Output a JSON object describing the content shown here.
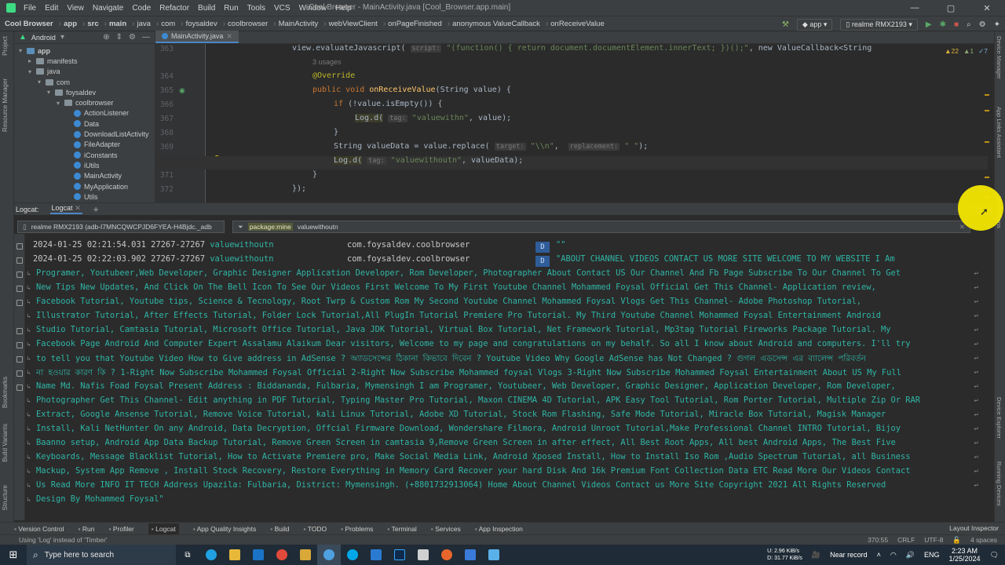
{
  "titlebar": {
    "menu": [
      "File",
      "Edit",
      "View",
      "Navigate",
      "Code",
      "Refactor",
      "Build",
      "Run",
      "Tools",
      "VCS",
      "Window",
      "Help"
    ],
    "title": "Cool Browser - MainActivity.java [Cool_Browser.app.main]",
    "win_min": "—",
    "win_max": "▢",
    "win_close": "✕"
  },
  "navbar": {
    "crumbs": [
      "Cool Browser",
      "app",
      "src",
      "main",
      "java",
      "com",
      "foysaldev",
      "coolbrowser",
      "MainActivity",
      "webViewClient",
      "onPageFinished",
      "anonymous ValueCallback",
      "onReceiveValue"
    ],
    "run_config": "app",
    "device": "realme RMX2193"
  },
  "project": {
    "view": "Android",
    "tree": [
      {
        "label": "app",
        "indent": 0,
        "kind": "folder-blue",
        "arrow": "▾"
      },
      {
        "label": "manifests",
        "indent": 1,
        "kind": "folder",
        "arrow": "▸"
      },
      {
        "label": "java",
        "indent": 1,
        "kind": "folder",
        "arrow": "▾"
      },
      {
        "label": "com",
        "indent": 2,
        "kind": "folder",
        "arrow": "▾"
      },
      {
        "label": "foysaldev",
        "indent": 3,
        "kind": "folder",
        "arrow": "▾"
      },
      {
        "label": "coolbrowser",
        "indent": 4,
        "kind": "folder",
        "arrow": "▾"
      },
      {
        "label": "ActionListener",
        "indent": 5,
        "kind": "class",
        "arrow": ""
      },
      {
        "label": "Data",
        "indent": 5,
        "kind": "class",
        "arrow": ""
      },
      {
        "label": "DownloadListActivity",
        "indent": 5,
        "kind": "class",
        "arrow": ""
      },
      {
        "label": "FileAdapter",
        "indent": 5,
        "kind": "class",
        "arrow": ""
      },
      {
        "label": "iConstants",
        "indent": 5,
        "kind": "class",
        "arrow": ""
      },
      {
        "label": "iUtils",
        "indent": 5,
        "kind": "class",
        "arrow": ""
      },
      {
        "label": "MainActivity",
        "indent": 5,
        "kind": "class",
        "arrow": ""
      },
      {
        "label": "MyApplication",
        "indent": 5,
        "kind": "class",
        "arrow": ""
      },
      {
        "label": "Utils",
        "indent": 5,
        "kind": "class",
        "arrow": ""
      }
    ]
  },
  "editor": {
    "tab": "MainActivity.java",
    "inspections": {
      "warnings": "22",
      "weak": "1",
      "typos": "7"
    },
    "usages": "3 usages",
    "lines": [
      "363",
      "364",
      "365",
      "366",
      "367",
      "368",
      "369",
      "370",
      "371",
      "372"
    ],
    "code_363": "view.evaluateJavascript(",
    "code_363_hint": "script:",
    "code_363_str": "\"(function() { return document.documentElement.innerText; })();\"",
    "code_363_tail": ", new ValueCallback<String",
    "code_364": "@Override",
    "code_365_a": "public void ",
    "code_365_fn": "onReceiveValue",
    "code_365_b": "(String value) {",
    "code_366_a": "if ",
    "code_366_b": "(!value.isEmpty()) {",
    "code_367_a": "Log.d(",
    "code_367_hint": "tag:",
    "code_367_str": "\"valuewithn\"",
    "code_367_b": ", value);",
    "code_368": "}",
    "code_369_a": "String valueData = value.replace(",
    "code_369_hint1": "target:",
    "code_369_str1": "\"\\\\n\"",
    "code_369_comma": ",",
    "code_369_hint2": "replacement:",
    "code_369_str2": "\" \"",
    "code_369_b": ");",
    "code_370_a": "Log.d(",
    "code_370_hint": "tag:",
    "code_370_str": "\"valuewithoutn\"",
    "code_370_b": ", valueData);",
    "code_371": "}",
    "code_372": "});"
  },
  "logcat": {
    "tabs": [
      "Logcat:",
      "Logcat"
    ],
    "device_filter": "realme RMX2193 (adb-I7MNCQWCPJD6FYEA-H4Bjdc._adb",
    "filter_key": "package:mine",
    "filter_value": "valuewithoutn",
    "rows": [
      {
        "time": "2024-01-25 02:21:54.031 27267-27267",
        "tag": "valuewithoutn",
        "pkg": "com.foysaldev.coolbrowser",
        "level": "D",
        "msg": "\"\""
      },
      {
        "time": "2024-01-25 02:22:03.902 27267-27267",
        "tag": "valuewithoutn",
        "pkg": "com.foysaldev.coolbrowser",
        "level": "D",
        "msg": "\"ABOUT   CHANNEL   VIDEOS   CONTACT US   MORE SITE   WELCOME TO MY WEBSITE  I Am"
      }
    ],
    "continuation": [
      "Programer, Youtubeer,Web Developer, Graphic Designer Application Developer, Rom Developer, Photographer  About Contact US Our Channel And Fb Page Subscribe To Our Channel To Get",
      "New Tips New Updates, And Click On The Bell Icon To See Our Videos First   Welcome To My First Youtube Channel Mohammed Foysal Official  Get This Channel- Application review,",
      "Facebook Tutorial, Youtube tips, Science & Tecnology, Root Twrp & Custom Rom    My Second Youtube Channel Mohammed Foysal Vlogs  Get This Channel- Adobe Photoshop Tutorial,",
      "Illustrator Tutorial, After Effects Tutorial, Folder Lock Tutorial,All PlugIn Tutorial Premiere Pro Tutorial.    My Third Youtube Channel Mohammed Foysal Entertainment  Android",
      "Studio Tutorial, Camtasia Tutorial, Microsoft Office Tutorial, Java JDK Tutorial, Virtual Box Tutorial, Net Framework Tutorial, Mp3tag Tutorial Fireworks Package Tutorial.   My",
      "Facebook Page Android And Computer Expert  Assalamu Alaikum Dear visitors, Welcome to my page and congratulations on my behalf. So all I know about Android and computers. I'll try",
      "to tell you that  Youtube Video   How to Give address in AdSense ? অ্যাডসেন্সের ঠিকানা কিভাবে দিবেন ? Youtube Video Why Google AdSense has Not Changed ? গুগল এডসেন্স এর ব্যালেন্স পরিবর্তন",
      "না হওয়ার কারণ কি ? 1-Right Now Subscribe Mohammed Foysal Official 2-Right Now Subscribe Mohammed foysal Vlogs 3-Right Now Subscribe Mohammed Foysal Entertainment About US My Full",
      "Name Md. Nafis Foad Foysal Present Address : Biddananda, Fulbaria, Mymensingh I am Programer, Youtubeer, Web Developer, Graphic Designer, Application Developer, Rom Developer,",
      "Photographer Get This Channel- Edit anything in PDF Tutorial, Typing Master Pro Tutorial, Maxon CINEMA 4D Tutorial, APK Easy Tool Tutorial, Rom Porter Tutorial, Multiple Zip Or RAR",
      " Extract, Google Ansense Tutorial, Remove Voice Tutorial, kali Linux Tutorial, Adobe XD Tutorial, Stock Rom Flashing, Safe Mode Tutorial, Miracle Box Tutorial, Magisk Manager",
      "Install, Kali NetHunter On any Android, Data Decryption, Offcial Firmware Download, Wondershare Filmora, Android Unroot Tutorial,Make Professional Channel INTRO Tutorial, Bijoy",
      "Baanno setup, Android App Data Backup Tutorial, Remove Green Screen in camtasia 9,Remove Green Screen in after effect, All Best Root Apps, All best Android Apps, The Best Five",
      "Keyboards, Message Blacklist Tutorial, How to Activate Premiere pro, Make Social Media Link, Android Xposed Install, How to Install Iso Rom ,Audio Spectrum Tutorial, all Business",
      "Mackup, System App Remove , Install Stock Recovery, Restore Everything in Memory Card Recover your hard Disk And 16k Premium Font Collection Data ETC Read More Our Videos Contact",
      "Us Read More INFO IT TECH Address Upazila: Fulbaria, District: Mymensingh.  (+8801732913064)  Home About Channel Videos Contact us More Site  Copyright 2021 All Rights Reserved",
      "Design By Mohammed Foysal\""
    ]
  },
  "left_tool": [
    "Project",
    "Resource Manager",
    "Bookmarks",
    "Build Variants",
    "Structure"
  ],
  "right_tool": [
    "Device Manager",
    "App Links Assistant",
    "Notifications",
    "Device Explorer",
    "Running Devices"
  ],
  "bottom_tools": [
    "Version Control",
    "Run",
    "Profiler",
    "Logcat",
    "App Quality Insights",
    "Build",
    "TODO",
    "Problems",
    "Terminal",
    "Services",
    "App Inspection"
  ],
  "layout_inspector": "Layout Inspector",
  "status": {
    "message": "Using 'Log' instead of 'Timber'",
    "position": "370:55",
    "line_sep": "CRLF",
    "encoding": "UTF-8",
    "indent": "4 spaces"
  },
  "taskbar": {
    "search_placeholder": "Type here to search",
    "net_up": "2.96 KiB/s",
    "net_down": "31.77 KiB/s",
    "net_up_label": "U:",
    "net_down_label": "D:",
    "recording": "Near record",
    "lang": "ENG",
    "time": "2:23 AM",
    "date": "1/25/2024"
  }
}
